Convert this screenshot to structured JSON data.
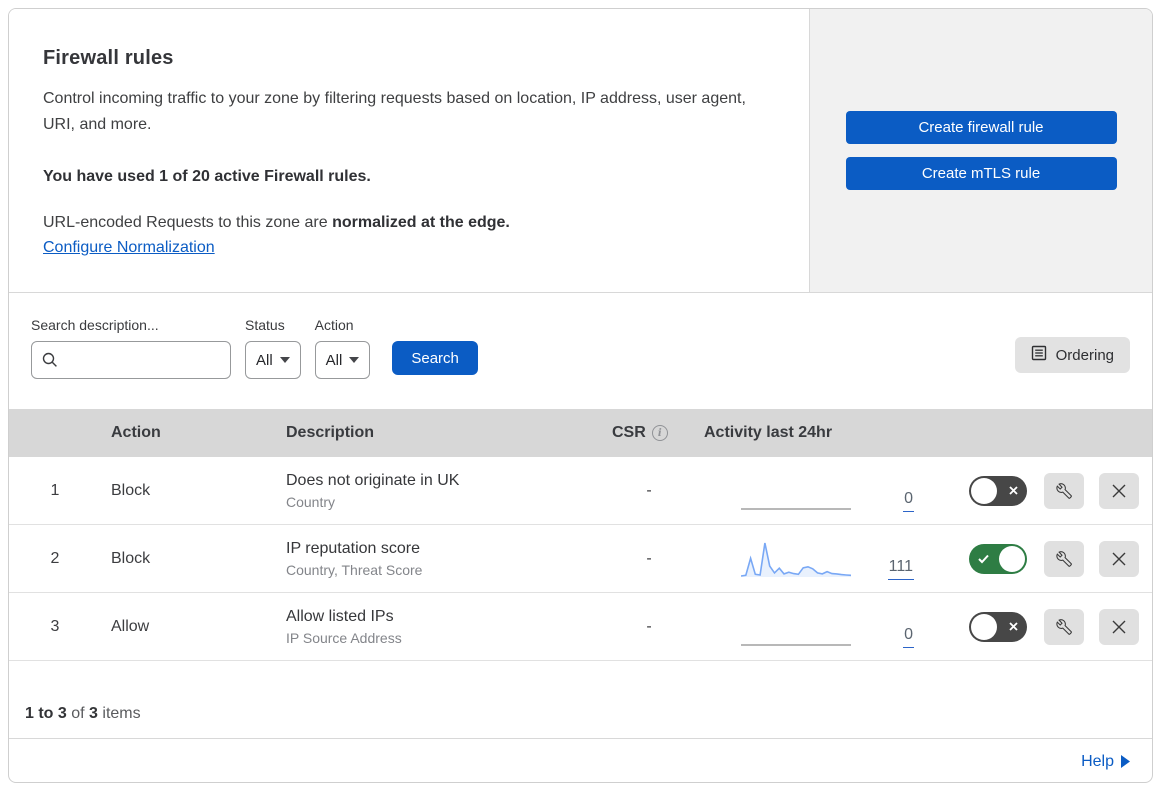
{
  "header": {
    "title": "Firewall rules",
    "description": "Control incoming traffic to your zone by filtering requests based on location, IP address, user agent, URI, and more.",
    "usage_notice": "You have used 1 of 20 active Firewall rules.",
    "normalization_text": "URL-encoded Requests to this zone are ",
    "normalization_bold": "normalized at the edge.",
    "normalization_link": "Configure Normalization",
    "create_firewall_button": "Create firewall rule",
    "create_mtls_button": "Create mTLS rule"
  },
  "filters": {
    "search_label": "Search description...",
    "search_value": "",
    "status_label": "Status",
    "status_value": "All",
    "action_label": "Action",
    "action_value": "All",
    "search_button": "Search",
    "ordering_button": "Ordering"
  },
  "table": {
    "columns": {
      "action": "Action",
      "description": "Description",
      "csr": "CSR",
      "activity": "Activity last 24hr"
    },
    "rows": [
      {
        "priority": "1",
        "action": "Block",
        "description": "Does not originate in UK",
        "fields": "Country",
        "csr": "-",
        "activity_count": "0",
        "enabled": false,
        "sparkline": [
          0,
          0,
          0,
          0,
          0,
          0,
          0,
          0,
          0,
          0,
          0,
          0,
          0,
          0,
          0,
          0,
          0,
          0,
          0,
          0,
          0,
          0,
          0,
          0
        ]
      },
      {
        "priority": "2",
        "action": "Block",
        "description": "IP reputation score",
        "fields": "Country, Threat Score",
        "csr": "-",
        "activity_count": "111",
        "enabled": true,
        "sparkline": [
          3,
          5,
          55,
          8,
          6,
          100,
          32,
          12,
          26,
          9,
          14,
          10,
          8,
          27,
          30,
          24,
          12,
          9,
          16,
          10,
          9,
          7,
          6,
          5
        ]
      },
      {
        "priority": "3",
        "action": "Allow",
        "description": "Allow listed IPs",
        "fields": "IP Source Address",
        "csr": "-",
        "activity_count": "0",
        "enabled": false,
        "sparkline": [
          0,
          0,
          0,
          0,
          0,
          0,
          0,
          0,
          0,
          0,
          0,
          0,
          0,
          0,
          0,
          0,
          0,
          0,
          0,
          0,
          0,
          0,
          0,
          0
        ]
      }
    ]
  },
  "footer": {
    "range_bold": "1 to 3",
    "of_text": " of ",
    "total_bold": "3",
    "items_text": " items",
    "help_link": "Help"
  },
  "chart_data": {
    "type": "line",
    "title": "Activity last 24hr",
    "series": [
      {
        "name": "rule-1-activity",
        "values": [
          0,
          0,
          0,
          0,
          0,
          0,
          0,
          0,
          0,
          0,
          0,
          0,
          0,
          0,
          0,
          0,
          0,
          0,
          0,
          0,
          0,
          0,
          0,
          0
        ],
        "total": 0
      },
      {
        "name": "rule-2-activity",
        "values": [
          3,
          5,
          55,
          8,
          6,
          100,
          32,
          12,
          26,
          9,
          14,
          10,
          8,
          27,
          30,
          24,
          12,
          9,
          16,
          10,
          9,
          7,
          6,
          5
        ],
        "total": 111
      },
      {
        "name": "rule-3-activity",
        "values": [
          0,
          0,
          0,
          0,
          0,
          0,
          0,
          0,
          0,
          0,
          0,
          0,
          0,
          0,
          0,
          0,
          0,
          0,
          0,
          0,
          0,
          0,
          0,
          0
        ],
        "total": 0
      }
    ]
  },
  "colors": {
    "accent_blue": "#0b5cc4",
    "panel_gray": "#f1f1f1",
    "table_header_gray": "#d7d7d7",
    "toggle_on_green": "#2e7d44",
    "toggle_off_gray": "#474747",
    "spark_line": "#79a8f5",
    "spark_fill": "rgba(121,168,245,0.16)",
    "spark_flat": "#b8b8b8",
    "link_underline": "#2c64c8"
  }
}
